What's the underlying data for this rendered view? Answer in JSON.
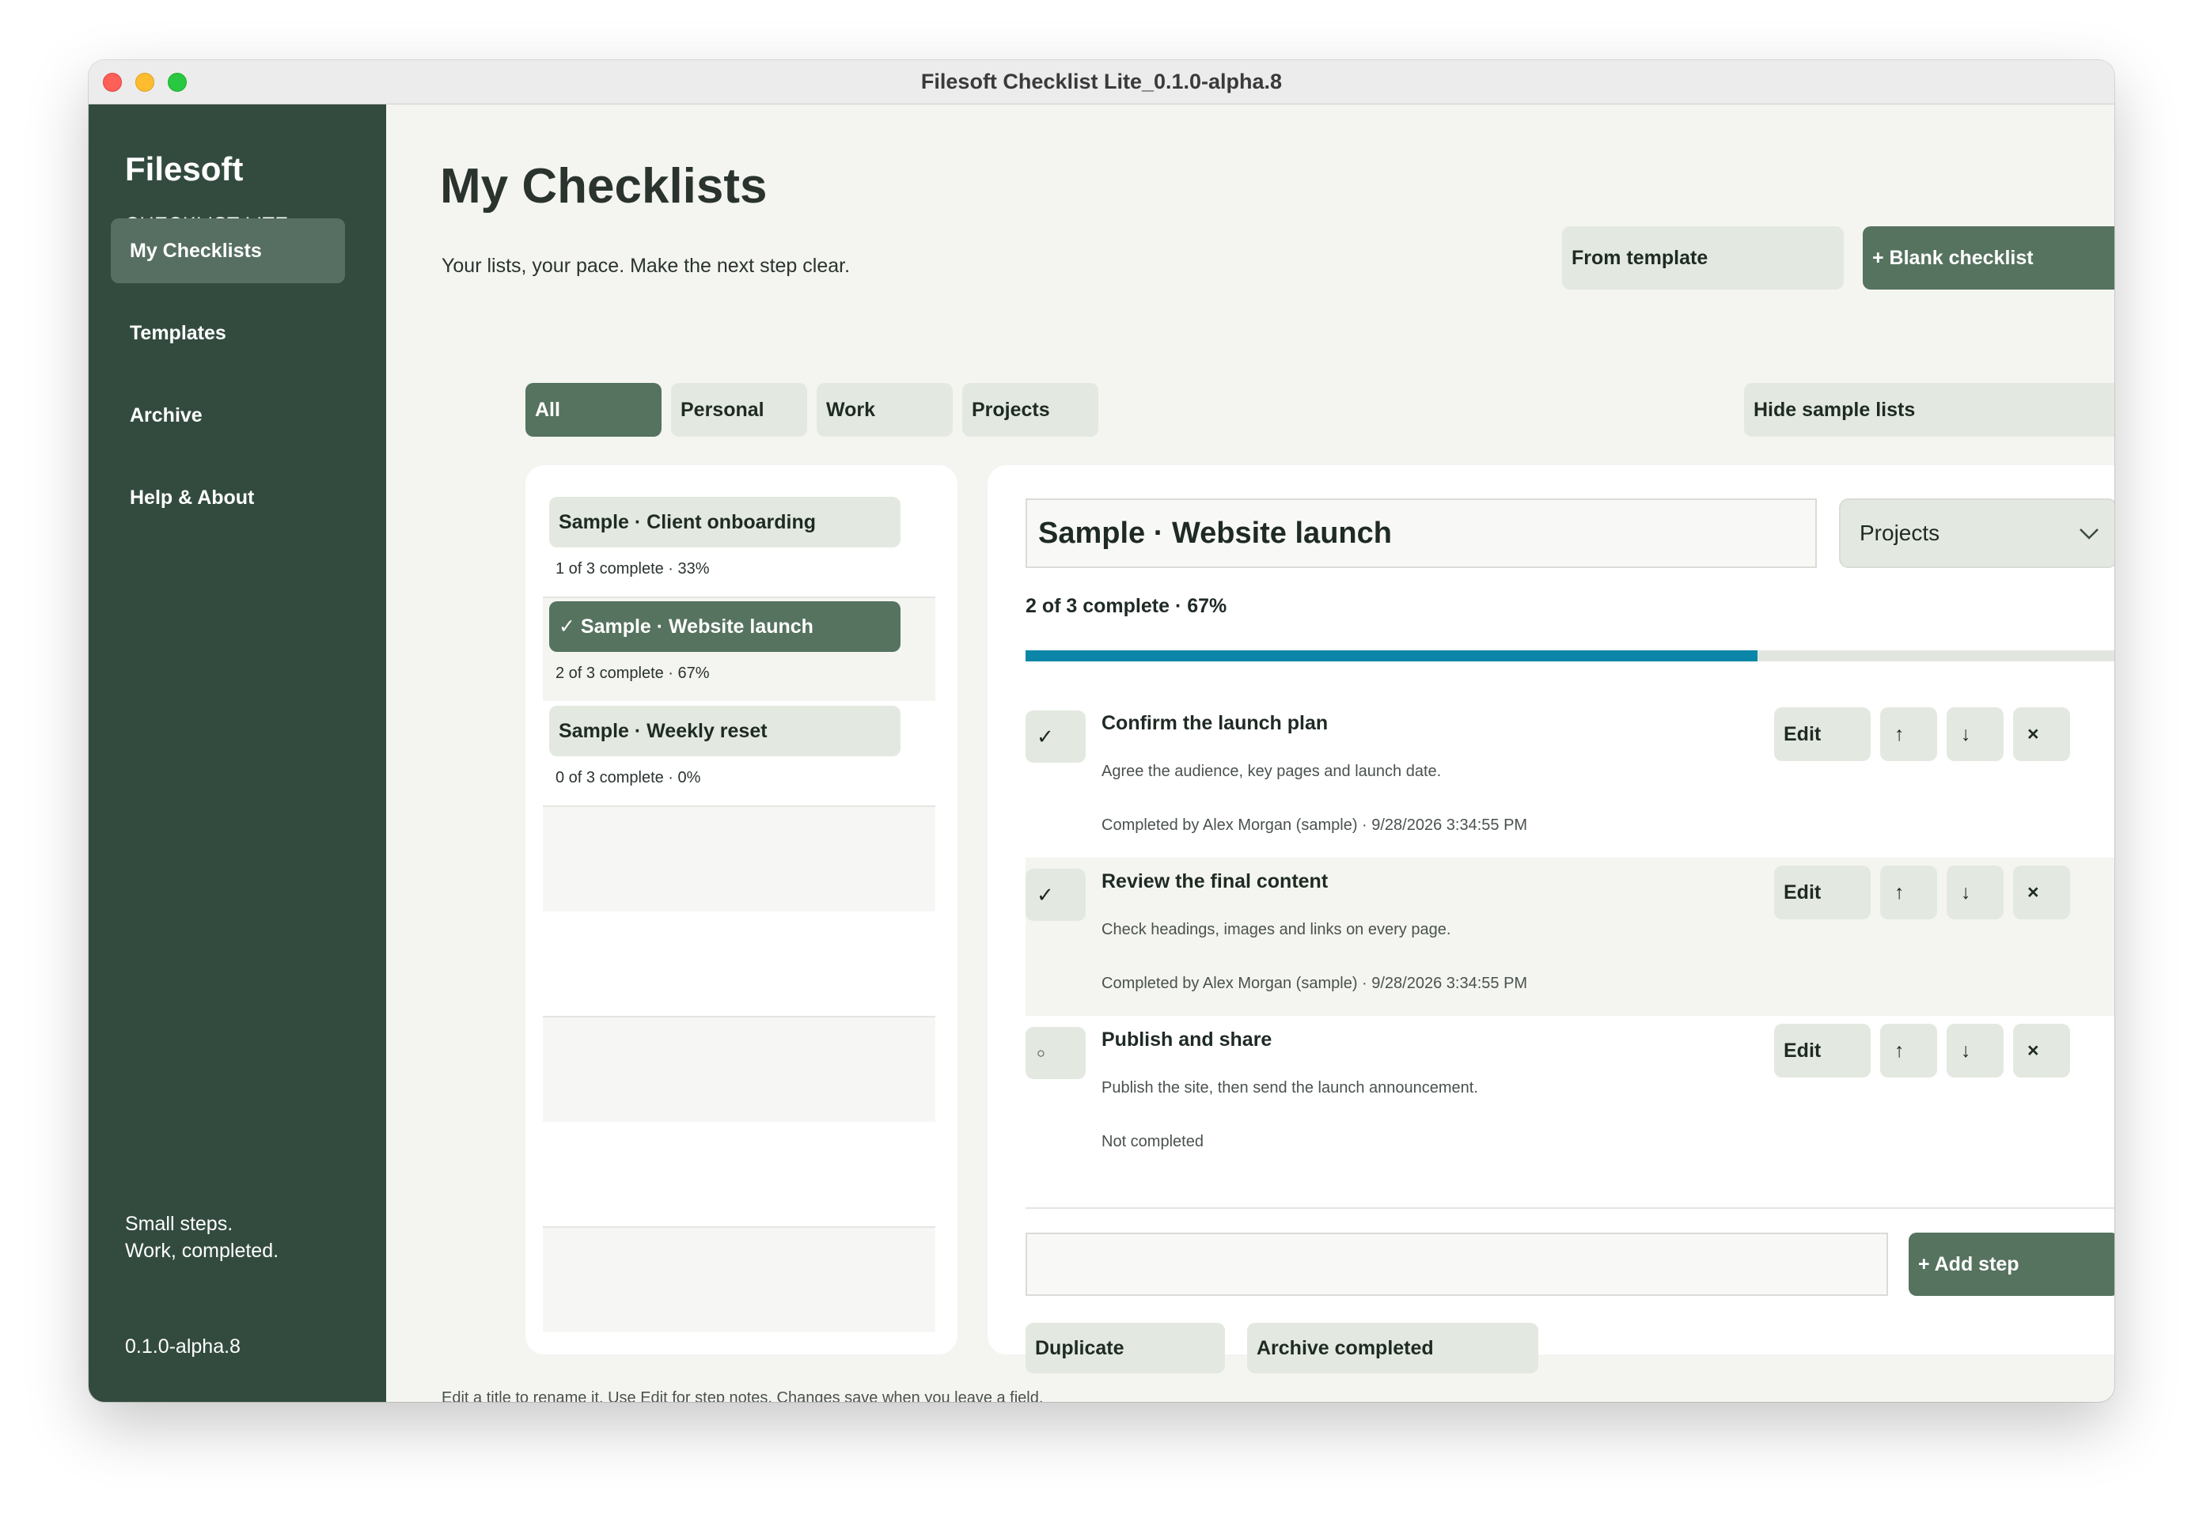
{
  "window": {
    "title": "Filesoft Checklist Lite_0.1.0-alpha.8"
  },
  "sidebar": {
    "brand": "Filesoft",
    "brand_sub": "CHECKLIST LITE",
    "items": [
      {
        "label": "My Checklists",
        "active": true
      },
      {
        "label": "Templates",
        "active": false
      },
      {
        "label": "Archive",
        "active": false
      },
      {
        "label": "Help & About",
        "active": false
      }
    ],
    "tagline_line1": "Small steps.",
    "tagline_line2": "Work, completed.",
    "version": "0.1.0-alpha.8"
  },
  "header": {
    "title": "My Checklists",
    "subtitle": "Your lists, your pace. Make the next step clear.",
    "from_template": "From template",
    "blank_checklist": "+ Blank checklist"
  },
  "filters": {
    "tabs": [
      {
        "label": "All",
        "active": true
      },
      {
        "label": "Personal",
        "active": false
      },
      {
        "label": "Work",
        "active": false
      },
      {
        "label": "Projects",
        "active": false
      }
    ],
    "hide_samples": "Hide sample lists"
  },
  "checklists": [
    {
      "title": "Sample · Client onboarding",
      "meta": "1 of 3 complete · 33%",
      "selected": false
    },
    {
      "title": "✓ Sample · Website launch",
      "meta": "2 of 3 complete · 67%",
      "selected": true
    },
    {
      "title": "Sample · Weekly reset",
      "meta": "0 of 3 complete · 0%",
      "selected": false
    }
  ],
  "detail": {
    "title": "Sample · Website launch",
    "category": "Projects",
    "progress_text": "2 of 3 complete · 67%",
    "progress_fraction": 0.67,
    "steps": [
      {
        "title": "Confirm the launch plan",
        "description": "Agree the audience, key pages and launch date.",
        "status": "Completed by Alex Morgan (sample) · 9/28/2026 3:34:55 PM",
        "check": "✓",
        "edit": "Edit",
        "up": "↑",
        "down": "↓",
        "remove": "×"
      },
      {
        "title": "Review the final content",
        "description": "Check headings, images and links on every page.",
        "status": "Completed by Alex Morgan (sample) · 9/28/2026 3:34:55 PM",
        "check": "✓",
        "edit": "Edit",
        "up": "↑",
        "down": "↓",
        "remove": "×"
      },
      {
        "title": "Publish and share",
        "description": "Publish the site, then send the launch announcement.",
        "status": "Not completed",
        "check": "○",
        "edit": "Edit",
        "up": "↑",
        "down": "↓",
        "remove": "×"
      }
    ],
    "new_step_value": "",
    "add_step": "+ Add step",
    "duplicate": "Duplicate",
    "archive_completed": "Archive completed"
  },
  "footer_hint": "Edit a title to rename it. Use Edit for step notes. Changes save when you leave a field.",
  "colors": {
    "sidebar_bg": "#334b3f",
    "accent": "#56735f",
    "chip_bg": "#e3e9e0",
    "progress": "#0b86a8"
  }
}
